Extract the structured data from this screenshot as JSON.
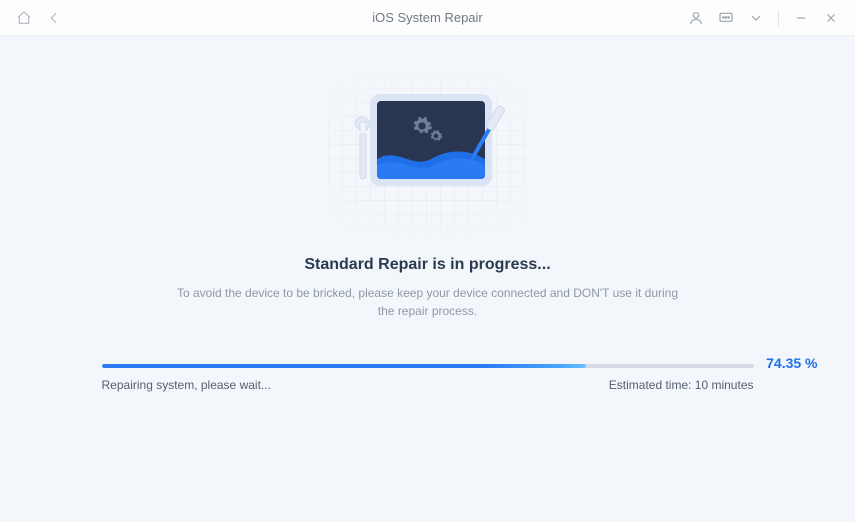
{
  "titlebar": {
    "title": "iOS System Repair"
  },
  "hero": {
    "heading": "Standard Repair is in progress...",
    "subtext": "To avoid the device to be bricked, please keep your device connected and DON'T use it during the repair process."
  },
  "progress": {
    "percent_text": "74.35 %",
    "percent_value": 74.35,
    "status": "Repairing system, please wait...",
    "eta": "Estimated time: 10 minutes"
  }
}
